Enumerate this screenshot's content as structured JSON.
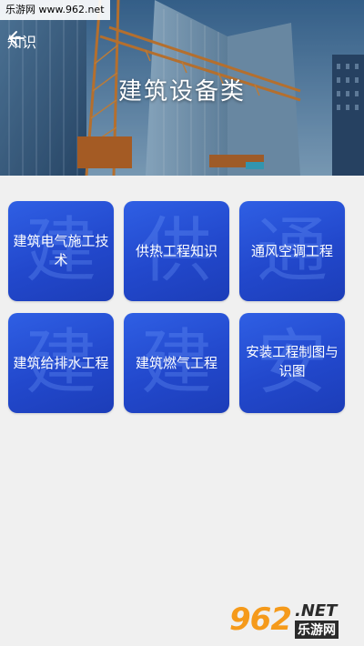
{
  "watermark": "乐游网 www.962.net",
  "header": {
    "back_label": "知识",
    "title": "建筑设备类"
  },
  "tiles": [
    {
      "label": "建筑电气施工技术",
      "bg_char": "建"
    },
    {
      "label": "供热工程知识",
      "bg_char": "供"
    },
    {
      "label": "通风空调工程",
      "bg_char": "通"
    },
    {
      "label": "建筑给排水工程",
      "bg_char": "建"
    },
    {
      "label": "建筑燃气工程",
      "bg_char": "建"
    },
    {
      "label": "安装工程制图与识图",
      "bg_char": "安"
    }
  ],
  "logo": {
    "number": "962",
    "net": ".NET",
    "cn": "乐游网"
  },
  "colors": {
    "tile": "#2248cc",
    "page_bg": "#f0f0f0",
    "logo_orange": "#f59a1b"
  }
}
